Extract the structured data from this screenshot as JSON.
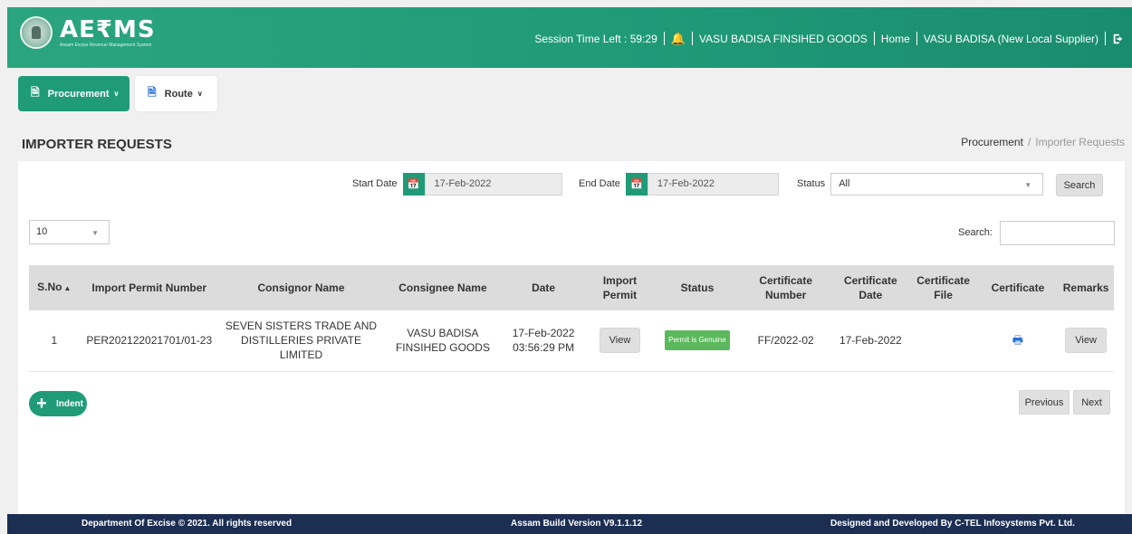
{
  "header": {
    "logo_text": "AE₹MS",
    "logo_subtitle": "Assam Excise Revenue Management System",
    "session_label": "Session Time Left : 59:29",
    "user_entity": "VASU BADISA FINSIHED GOODS",
    "home_link": "Home",
    "user_role": "VASU BADISA (New Local Supplier)",
    "icons": [
      "emblem",
      "bell-icon",
      "logout-icon"
    ]
  },
  "nav": {
    "items": [
      {
        "label": "Procurement",
        "icon": "document-icon",
        "active": true
      },
      {
        "label": "Route",
        "icon": "route-icon",
        "active": false
      }
    ]
  },
  "page": {
    "title": "IMPORTER REQUESTS",
    "breadcrumb": [
      "Procurement",
      "Importer Requests"
    ]
  },
  "filters": {
    "start_date_label": "Start Date",
    "start_date": "17-Feb-2022",
    "end_date_label": "End Date",
    "end_date": "17-Feb-2022",
    "status_label": "Status",
    "status_value": "All",
    "search_button": "Search"
  },
  "table_controls": {
    "page_length": "10",
    "search_label": "Search:"
  },
  "table": {
    "columns": [
      "S.No",
      "Import Permit Number",
      "Consignor Name",
      "Consignee Name",
      "Date",
      "Import Permit",
      "Status",
      "Certificate Number",
      "Certificate Date",
      "Certificate File",
      "Certificate",
      "Remarks"
    ],
    "rows": [
      {
        "sno": "1",
        "permit_number": "PER202122021701/01-23",
        "consignor": "SEVEN SISTERS TRADE AND DISTILLERIES PRIVATE LIMITED",
        "consignee": "VASU BADISA FINSIHED GOODS",
        "date": "17-Feb-2022 03:56:29 PM",
        "import_permit": "View",
        "status": "Permit is Genuine",
        "certificate_number": "FF/2022-02",
        "certificate_date": "17-Feb-2022",
        "certificate_file": "",
        "remarks": "View"
      }
    ]
  },
  "actions": {
    "indent": "Indent",
    "previous": "Previous",
    "next": "Next"
  },
  "footer": {
    "copyright": "Department Of Excise © 2021. All rights reserved",
    "build": "Assam Build Version V9.1.1.12",
    "developer": "Designed and Developed By C-TEL Infosystems Pvt. Ltd."
  },
  "colors": {
    "primary": "#1f9b78",
    "footer": "#1c2e52",
    "status_badge": "#5cb85c",
    "print_icon": "#2b6fd6"
  }
}
